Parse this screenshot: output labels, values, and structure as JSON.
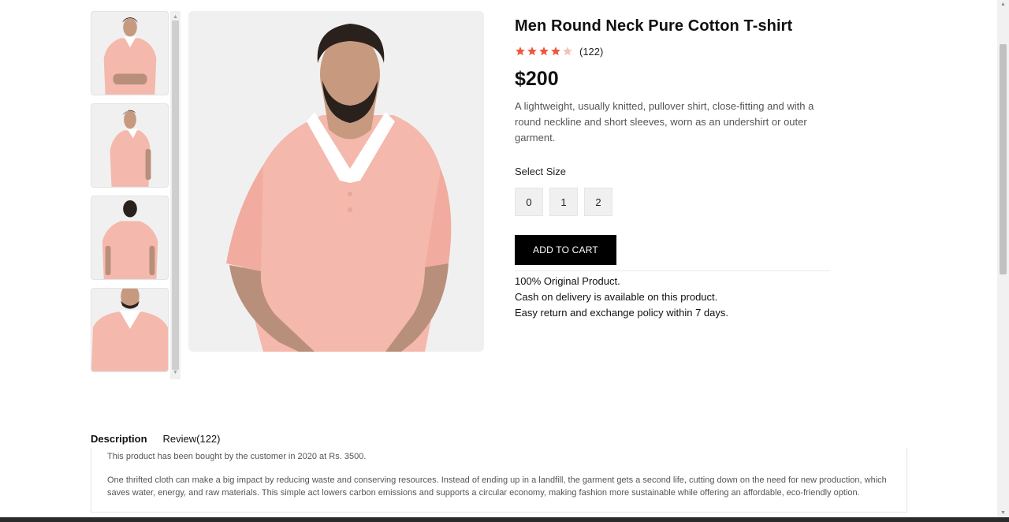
{
  "product": {
    "title": "Men Round Neck Pure Cotton T-shirt",
    "rating": 4,
    "rating_max": 5,
    "rating_count": "(122)",
    "price": "$200",
    "description": "A lightweight, usually knitted, pullover shirt, close-fitting and with a round neckline and short sleeves, worn as an undershirt or outer garment.",
    "size_label": "Select Size",
    "sizes": [
      "0",
      "1",
      "2"
    ],
    "add_to_cart": "ADD TO CART",
    "notes": [
      "100% Original Product.",
      "Cash on delivery is available on this product.",
      "Easy return and exchange policy within 7 days."
    ]
  },
  "colors": {
    "star_filled": "#f0563a",
    "star_empty": "#f5c2b8",
    "shirt": "#f4b8ac",
    "button_bg": "#000000"
  },
  "tabs": {
    "description_label": "Description",
    "review_label": "Review(122)"
  },
  "tab_content": {
    "p1": "This product has been bought by the customer in 2020 at Rs. 3500.",
    "p2": "One thrifted cloth can make a big impact by reducing waste and conserving resources. Instead of ending up in a landfill, the garment gets a second life, cutting down on the need for new production, which saves water, energy, and raw materials. This simple act lowers carbon emissions and supports a circular economy, making fashion more sustainable while offering an affordable, eco-friendly option."
  },
  "icons": {
    "scroll_up": "▲",
    "scroll_down": "▼"
  }
}
